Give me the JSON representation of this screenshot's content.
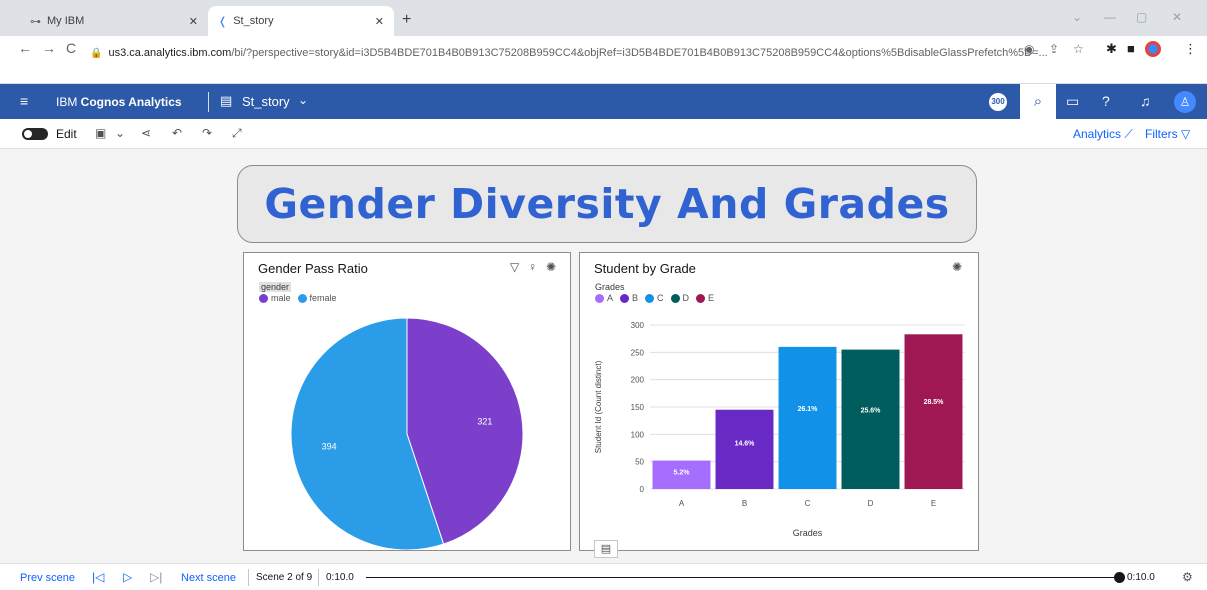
{
  "browser": {
    "tabs": [
      {
        "label": "My IBM",
        "favicon": "ibm-logo-icon"
      },
      {
        "label": "St_story",
        "favicon": "cognos-logo-icon"
      }
    ],
    "url_host": "us3.ca.analytics.ibm.com",
    "url_path": "/bi/?perspective=story&id=i3D5B4BDE701B4B0B913C75208B959CC4&objRef=i3D5B4BDE701B4B0B913C75208B959CC4&options%5BdisableGlassPrefetch%5D=..."
  },
  "appbar": {
    "brand_prefix": "IBM ",
    "brand_bold": "Cognos Analytics",
    "story_name": "St_story",
    "badge": "300",
    "bg_color": "#2c59a8"
  },
  "toolbar": {
    "edit_label": "Edit",
    "analytics_label": "Analytics",
    "filters_label": "Filters"
  },
  "story": {
    "title": "Gender Diversity And Grades",
    "title_color": "#3062d1"
  },
  "pie_card": {
    "title": "Gender Pass Ratio",
    "legend_title": "gender",
    "legend": [
      {
        "label": "male",
        "color": "#7b3fcc"
      },
      {
        "label": "female",
        "color": "#2b9de8"
      }
    ]
  },
  "bar_card": {
    "title": "Student by Grade",
    "legend_title": "Grades",
    "legend": [
      {
        "label": "A",
        "color": "#a56eff"
      },
      {
        "label": "B",
        "color": "#6929c4"
      },
      {
        "label": "C",
        "color": "#1192e8"
      },
      {
        "label": "D",
        "color": "#005d5d"
      },
      {
        "label": "E",
        "color": "#9f1853"
      }
    ]
  },
  "chart_data": [
    {
      "type": "pie",
      "title": "Gender Pass Ratio",
      "categories": [
        "male",
        "female"
      ],
      "values": [
        321,
        394
      ],
      "colors": [
        "#7b3fcc",
        "#2b9de8"
      ]
    },
    {
      "type": "bar",
      "title": "Student by Grade",
      "categories": [
        "A",
        "B",
        "C",
        "D",
        "E"
      ],
      "values": [
        52,
        145,
        260,
        255,
        283
      ],
      "data_labels": [
        "5.2%",
        "14.6%",
        "26.1%",
        "25.6%",
        "28.5%"
      ],
      "colors": [
        "#a56eff",
        "#6929c4",
        "#1192e8",
        "#005d5d",
        "#9f1853"
      ],
      "xlabel": "Grades",
      "ylabel": "Student Id (Count distinct)",
      "ylim": [
        0,
        300
      ],
      "yticks": [
        0,
        50,
        100,
        150,
        200,
        250,
        300
      ],
      "grid": true
    }
  ],
  "bottombar": {
    "prev_label": "Prev scene",
    "next_label": "Next scene",
    "scene_label": "Scene 2 of 9",
    "time_start": "0:10.0",
    "time_end": "0:10.0"
  }
}
